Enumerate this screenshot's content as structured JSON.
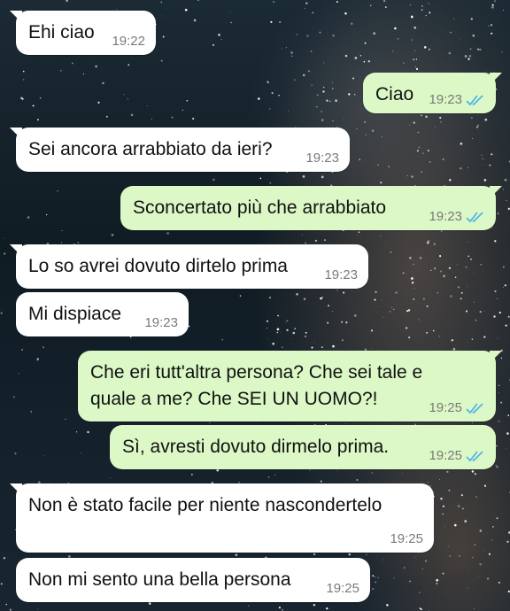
{
  "chat": {
    "messages": [
      {
        "direction": "in",
        "text": "Ehi ciao",
        "time": "19:22"
      },
      {
        "direction": "out",
        "text": "Ciao",
        "time": "19:23",
        "status": "read"
      },
      {
        "direction": "in",
        "text": "Sei ancora arrabbiato da ieri?",
        "time": "19:23"
      },
      {
        "direction": "out",
        "text": "Sconcertato più che arrabbiato",
        "time": "19:23",
        "status": "read"
      },
      {
        "direction": "in",
        "text": "Lo so avrei dovuto dirtelo prima",
        "time": "19:23"
      },
      {
        "direction": "in",
        "text": "Mi dispiace",
        "time": "19:23"
      },
      {
        "direction": "out",
        "text": "Che eri tutt'altra persona? Che sei tale e quale a me? Che SEI UN UOMO?!",
        "time": "19:25",
        "status": "read"
      },
      {
        "direction": "out",
        "text": "Sì, avresti dovuto dirmelo prima.",
        "time": "19:25",
        "status": "read"
      },
      {
        "direction": "in",
        "text": "Non è stato facile per niente nascondertelo",
        "time": "19:25"
      },
      {
        "direction": "in",
        "text": "Non mi sento una bella persona",
        "time": "19:25"
      }
    ]
  },
  "colors": {
    "incoming_bubble": "#ffffff",
    "outgoing_bubble": "#dcf8c6",
    "read_ticks": "#4fb6ec",
    "timestamp": "#7a7a7a"
  },
  "icons": {
    "read_receipt": "double-check-icon"
  }
}
